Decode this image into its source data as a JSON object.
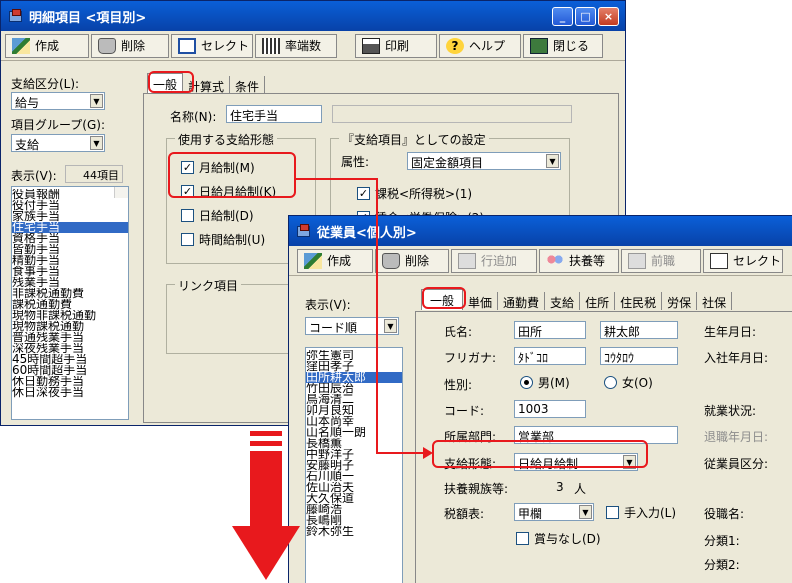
{
  "w1": {
    "title": "明細項目 <項目別>",
    "toolbar": [
      "作成",
      "削除",
      "セレクト",
      "率端数",
      "印刷",
      "ヘルプ",
      "閉じる"
    ],
    "kubun_label": "支給区分(L):",
    "kubun_value": "給与",
    "group_label": "項目グループ(G):",
    "group_value": "支給",
    "hyouji_label": "表示(V):",
    "count": "44項目",
    "items": [
      "役員報酬",
      "役付手当",
      "家族手当",
      "住宅手当",
      "資格手当",
      "皆勤手当",
      "精勤手当",
      "食事手当",
      "残業手当",
      "非課税通勤費",
      "課税通勤費",
      "現物非課税通勤",
      "現物課税通勤",
      "普通残業手当",
      "深夜残業手当",
      "45時間超手当",
      "60時間超手当",
      "休日勤務手当",
      "休日深夜手当"
    ],
    "selected_index": 3,
    "tabs": [
      "一般",
      "計算式",
      "条件"
    ],
    "name_label": "名称(N):",
    "name_value": "住宅手当",
    "keitai_group": "使用する支給形態",
    "keitai": [
      {
        "label": "月給制(M)",
        "checked": true
      },
      {
        "label": "日給月給制(K)",
        "checked": true
      },
      {
        "label": "日給制(D)",
        "checked": false
      },
      {
        "label": "時間給制(U)",
        "checked": false
      }
    ],
    "setting_group": "『支給項目』としての設定",
    "zokusei_label": "属性:",
    "zokusei_value": "固定金額項目",
    "kazei": [
      {
        "label": "課税<所得税>(1)",
        "checked": true
      },
      {
        "label": "賃金<労働保険>(2)",
        "checked": true
      }
    ],
    "link_group": "リンク項目"
  },
  "w2": {
    "title": "従業員<個人別>",
    "toolbar": [
      "作成",
      "削除",
      "行追加",
      "扶養等",
      "前職",
      "セレクト"
    ],
    "hyouji_label": "表示(V):",
    "order_value": "コード順",
    "employees": [
      "弥生憲司",
      "窪田孝子",
      "田所耕太郎",
      "竹田辰治",
      "鳥海清二",
      "卯月良知",
      "山本尚幸",
      "山名順一朗",
      "長橋薫",
      "中野洋子",
      "安藤明子",
      "石川順一",
      "佐山治夫",
      "大久保道",
      "藤崎浩",
      "長嶋剛",
      "鈴木弥生"
    ],
    "selected_index": 2,
    "tabs": [
      "一般",
      "単価",
      "通勤費",
      "支給",
      "住所",
      "住民税",
      "労保",
      "社保"
    ],
    "name_label": "氏名:",
    "sei": "田所",
    "mei": "耕太郎",
    "kana_label": "フリガナ:",
    "kana_sei": "ﾀﾄﾞｺﾛ",
    "kana_mei": "ｺｳﾀﾛｳ",
    "sex_label": "性別:",
    "male": "男(M)",
    "female": "女(O)",
    "code_label": "コード:",
    "code_value": "1003",
    "dept_label": "所属部門:",
    "dept_value": "営業部",
    "keitai_label": "支給形態:",
    "keitai_value": "日給月給制",
    "fuyou_label": "扶養親族等:",
    "fuyou_value": "3",
    "fuyou_unit": "人",
    "zeigaku_label": "税額表:",
    "zeigaku_value": "甲欄",
    "tenyuryoku": "手入力(L)",
    "shoyo_nashi": "賞与なし(D)",
    "right_labels": [
      "生年月日:",
      "入社年月日:",
      "就業状況:",
      "退職年月日:",
      "従業員区分:",
      "役職名:",
      "分類1:",
      "分類2:"
    ]
  }
}
